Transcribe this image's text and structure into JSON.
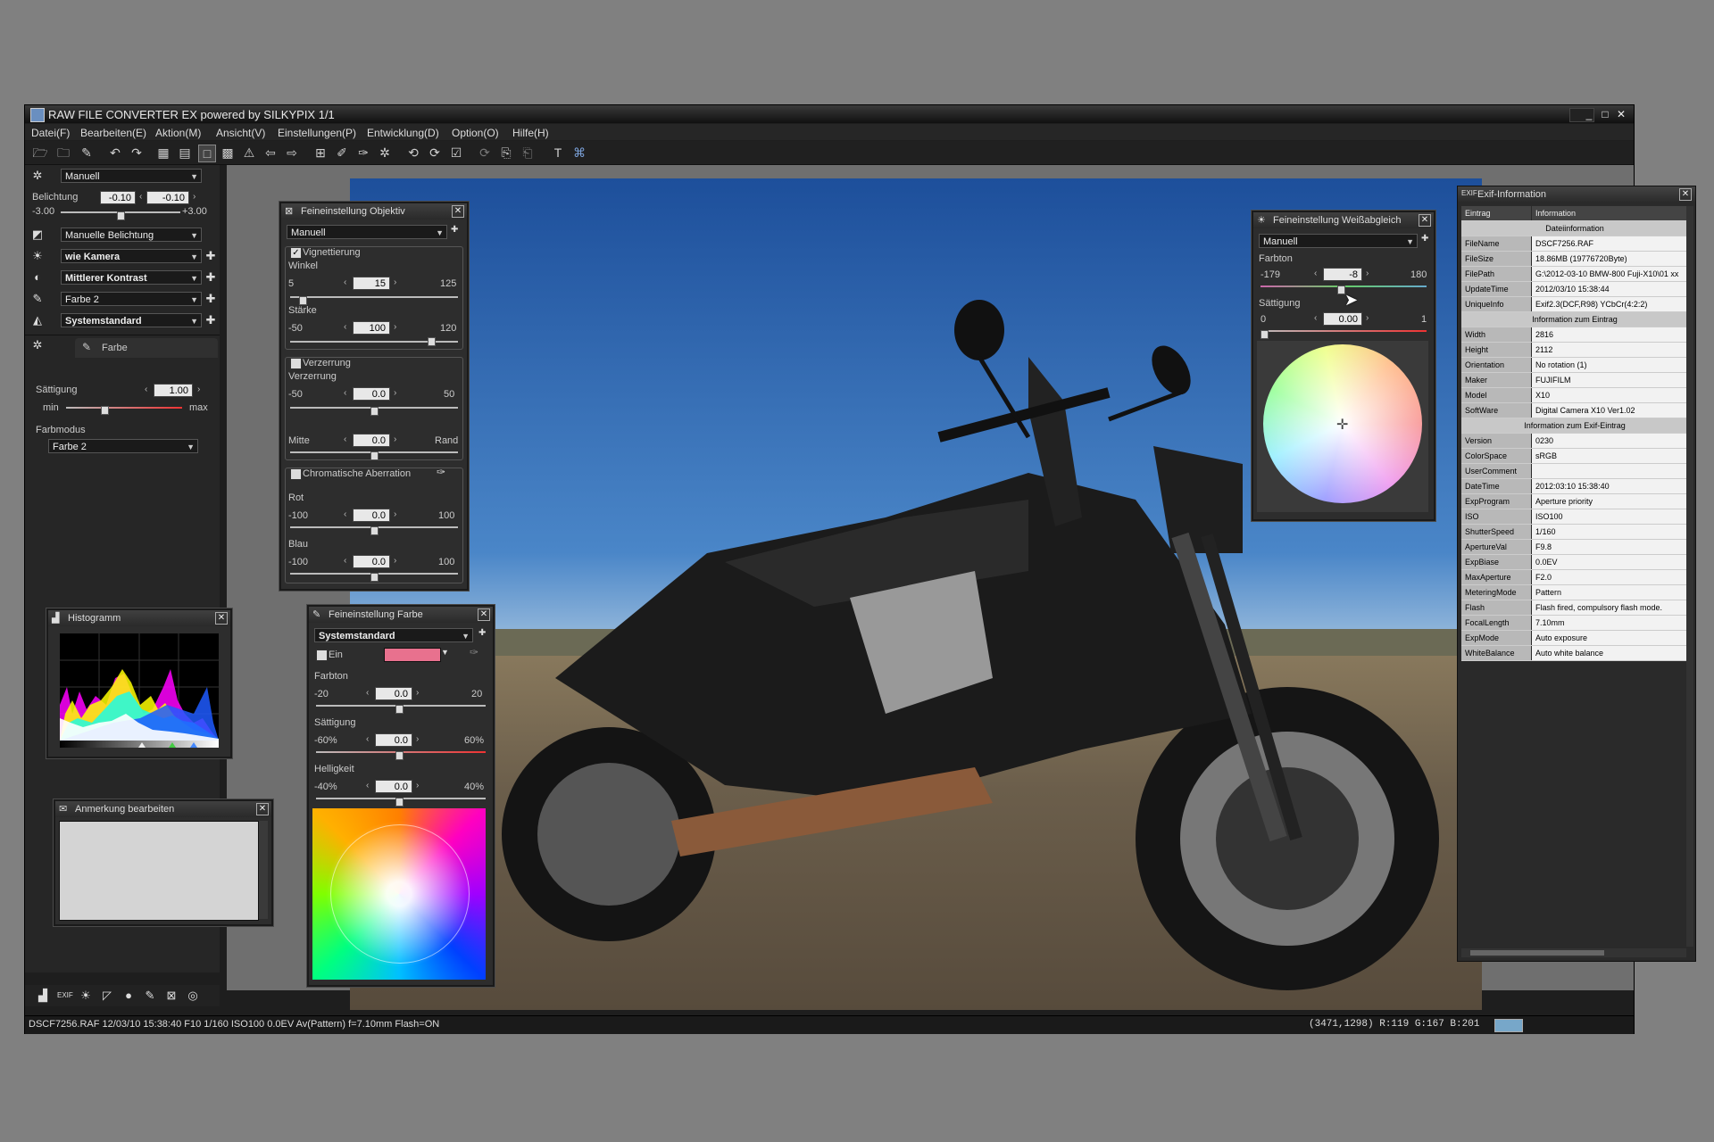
{
  "window": {
    "title": "RAW FILE CONVERTER EX powered by SILKYPIX   1/1"
  },
  "menu": [
    "Datei(F)",
    "Bearbeiten(E)",
    "Aktion(M)",
    "Ansicht(V)",
    "Einstellungen(P)",
    "Entwicklung(D)",
    "Option(O)",
    "Hilfe(H)"
  ],
  "left": {
    "mode": "Manuell",
    "exposure_label": "Belichtung",
    "exposure_val1": "-0.10",
    "exposure_val2": "-0.10",
    "exposure_min": "-3.00",
    "exposure_max": "+3.00",
    "exposure_mode": "Manuelle Belichtung",
    "wb": "wie Kamera",
    "contrast": "Mittlerer Kontrast",
    "color": "Farbe 2",
    "sharpness": "Systemstandard",
    "tab_farbe": "Farbe",
    "sat_label": "Sättigung",
    "sat_val": "1.00",
    "sat_min": "min",
    "sat_max": "max",
    "farbmodus_label": "Farbmodus",
    "farbmodus": "Farbe 2"
  },
  "objektiv": {
    "title": "Feineinstellung Objektiv",
    "mode": "Manuell",
    "vignette": "Vignettierung",
    "winkel": "Winkel",
    "winkel_min": "5",
    "winkel_val": "15",
    "winkel_max": "125",
    "staerke": "Stärke",
    "staerke_min": "-50",
    "staerke_val": "100",
    "staerke_max": "120",
    "verzerrung_grp": "Verzerrung",
    "verzerrung": "Verzerrung",
    "verz_min": "-50",
    "verz_val": "0.0",
    "verz_max": "50",
    "mitte": "Mitte",
    "mitte_val": "0.0",
    "rand": "Rand",
    "chrom": "Chromatische Aberration",
    "rot": "Rot",
    "rot_min": "-100",
    "rot_val": "0.0",
    "rot_max": "100",
    "blau": "Blau",
    "blau_min": "-100",
    "blau_val": "0.0",
    "blau_max": "100"
  },
  "histogram": {
    "title": "Histogramm"
  },
  "note": {
    "title": "Anmerkung bearbeiten"
  },
  "farbe": {
    "title": "Feineinstellung Farbe",
    "mode": "Systemstandard",
    "ein": "Ein",
    "swatch": "#e8718e",
    "farbton": "Farbton",
    "ft_min": "-20",
    "ft_val": "0.0",
    "ft_max": "20",
    "saett": "Sättigung",
    "s_min": "-60%",
    "s_val": "0.0",
    "s_max": "60%",
    "hell": "Helligkeit",
    "h_min": "-40%",
    "h_val": "0.0",
    "h_max": "40%"
  },
  "wb_panel": {
    "title": "Feineinstellung Weißabgleich",
    "mode": "Manuell",
    "farbton": "Farbton",
    "ft_min": "-179",
    "ft_val": "-8",
    "ft_max": "180",
    "saett": "Sättigung",
    "s_min": "0",
    "s_val": "0.00",
    "s_max": "1"
  },
  "exif": {
    "title": "Exif-Information",
    "col_key": "Eintrag",
    "col_val": "Information",
    "sections": [
      {
        "name": "Dateiinformation",
        "rows": [
          [
            "FileName",
            "DSCF7256.RAF"
          ],
          [
            "FileSize",
            "18.86MB (19776720Byte)"
          ],
          [
            "FilePath",
            "G:\\2012-03-10 BMW-800 Fuji-X10\\01 xx"
          ],
          [
            "UpdateTime",
            "2012/03/10 15:38:44"
          ],
          [
            "UniqueInfo",
            "Exif2.3(DCF,R98) YCbCr(4:2:2)"
          ]
        ]
      },
      {
        "name": "Information zum Eintrag",
        "rows": [
          [
            "Width",
            "2816"
          ],
          [
            "Height",
            "2112"
          ],
          [
            "Orientation",
            "No rotation (1)"
          ],
          [
            "Maker",
            "FUJIFILM"
          ],
          [
            "Model",
            "X10"
          ],
          [
            "SoftWare",
            "Digital Camera X10 Ver1.02"
          ]
        ]
      },
      {
        "name": "Information zum Exif-Eintrag",
        "rows": [
          [
            "Version",
            "0230"
          ],
          [
            "ColorSpace",
            "sRGB"
          ],
          [
            "UserComment",
            ""
          ],
          [
            "DateTime",
            "2012:03:10 15:38:40"
          ],
          [
            "ExpProgram",
            "Aperture priority"
          ],
          [
            "ISO",
            "ISO100"
          ],
          [
            "ShutterSpeed",
            "1/160"
          ],
          [
            "ApertureVal",
            "F9.8"
          ],
          [
            "ExpBiase",
            "0.0EV"
          ],
          [
            "MaxAperture",
            "F2.0"
          ],
          [
            "MeteringMode",
            "Pattern"
          ],
          [
            "Flash",
            "Flash fired, compulsory flash mode."
          ],
          [
            "FocalLength",
            "7.10mm"
          ],
          [
            "ExpMode",
            "Auto exposure"
          ],
          [
            "WhiteBalance",
            "Auto white balance"
          ]
        ]
      }
    ]
  },
  "status": {
    "left": "DSCF7256.RAF 12/03/10 15:38:40 F10  1/160 ISO100  0.0EV Av(Pattern) f=7.10mm Flash=ON",
    "right": "(3471,1298) R:119 G:167 B:201",
    "swatch": "#77a7c9"
  }
}
